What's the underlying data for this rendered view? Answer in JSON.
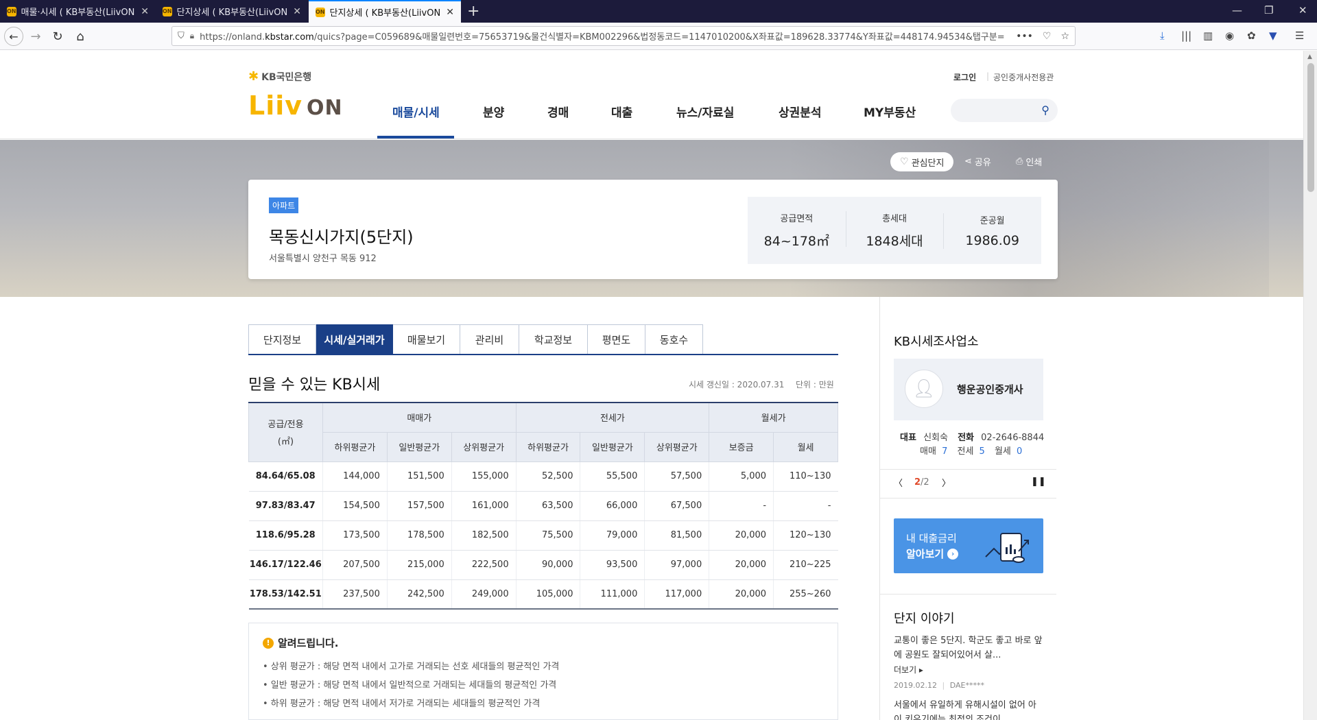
{
  "browser": {
    "tabs": [
      {
        "title": "매물·시세 ( KB부동산(LiivON) |",
        "active": false
      },
      {
        "title": "단지상세 ( KB부동산(LiivON) |",
        "active": false
      },
      {
        "title": "단지상세 ( KB부동산(LiivON) |",
        "active": true
      }
    ],
    "url_prefix": "https://onland.",
    "url_domain": "kbstar.com",
    "url_rest": "/quics?page=C059689&매물일련번호=75653719&물건식별자=KBM002296&법정동코드=1147010200&X좌표값=189628.33774&Y좌표값=448174.94534&탭구분=",
    "url_more": "•••"
  },
  "header": {
    "kb_brand": "KB국민은행",
    "liiv_brand": "Liiv",
    "on_brand": "ON",
    "login": "로그인",
    "broker_link": "공인중개사전용관",
    "gnb": [
      "매물/시세",
      "분양",
      "경매",
      "대출",
      "뉴스/자료실",
      "상권분석",
      "MY부동산"
    ],
    "active_index": 0
  },
  "hero": {
    "favorite": "관심단지",
    "share": "공유",
    "print": "인쇄",
    "type_badge": "아파트",
    "name": "목동신시가지(5단지)",
    "address": "서울특별시 양천구 목동 912",
    "stats": [
      {
        "label": "공급면적",
        "value": "84~178㎡"
      },
      {
        "label": "총세대",
        "value": "1848세대"
      },
      {
        "label": "준공월",
        "value": "1986.09"
      }
    ]
  },
  "tabs": [
    "단지정보",
    "시세/실거래가",
    "매물보기",
    "관리비",
    "학교정보",
    "평면도",
    "동호수"
  ],
  "active_tab": 1,
  "price": {
    "title": "믿을 수 있는 KB시세",
    "updated": "시세 갱신일 : 2020.07.31",
    "unit": "단위 : 만원",
    "header_area_1": "공급/전용",
    "header_area_2": "(㎡)",
    "groups": [
      "매매가",
      "전세가",
      "월세가"
    ],
    "sub_headers": [
      "하위평균가",
      "일반평균가",
      "상위평균가",
      "하위평균가",
      "일반평균가",
      "상위평균가",
      "보증금",
      "월세"
    ],
    "rows": [
      [
        "84.64/65.08",
        "144,000",
        "151,500",
        "155,000",
        "52,500",
        "55,500",
        "57,500",
        "5,000",
        "110~130"
      ],
      [
        "97.83/83.47",
        "154,500",
        "157,500",
        "161,000",
        "63,500",
        "66,000",
        "67,500",
        "-",
        "-"
      ],
      [
        "118.6/95.28",
        "173,500",
        "178,500",
        "182,500",
        "75,500",
        "79,000",
        "81,500",
        "20,000",
        "120~130"
      ],
      [
        "146.17/122.46",
        "207,500",
        "215,000",
        "222,500",
        "90,000",
        "93,500",
        "97,000",
        "20,000",
        "210~225"
      ],
      [
        "178.53/142.51",
        "237,500",
        "242,500",
        "249,000",
        "105,000",
        "111,000",
        "117,000",
        "20,000",
        "255~260"
      ]
    ]
  },
  "notice": {
    "title": "알려드립니다.",
    "lines": [
      "• 상위 평균가 : 해당 면적 내에서 고가로 거래되는 선호 세대들의 평균적인 가격",
      "• 일반 평균가 : 해당 면적 내에서 일반적으로 거래되는 세대들의 평균적인 가격",
      "• 하위 평균가 : 해당 면적 내에서 저가로 거래되는 세대들의 평균적인 가격"
    ]
  },
  "sidebar": {
    "broker_section": "KB시세조사업소",
    "broker_name": "행운공인중개사",
    "rep_label": "대표",
    "rep_name": "신회숙",
    "phone_label": "전화",
    "phone": "02-2646-8844",
    "sale_label": "매매",
    "sale_count": "7",
    "jeonse_label": "전세",
    "jeonse_count": "5",
    "monthly_label": "월세",
    "monthly_count": "0",
    "page_current": "2",
    "page_total": "/2",
    "loan_line1": "내 대출금리",
    "loan_line2": "알아보기",
    "story_title": "단지 이야기",
    "story1": "교통이 좋은 5단지. 학군도 좋고 바로 앞에 공원도 잘되어있어서 살...",
    "more": "더보기 ▸",
    "story1_date": "2019.02.12",
    "story1_user": "DAE*****",
    "story2": "서울에서 유일하게 유해시설이 없어 아이 키우기에는 최적의 조건이"
  },
  "colors": {
    "brand_navy": "#1a3f87",
    "accent_yellow": "#f7b500",
    "link_blue": "#2b6fd6"
  }
}
